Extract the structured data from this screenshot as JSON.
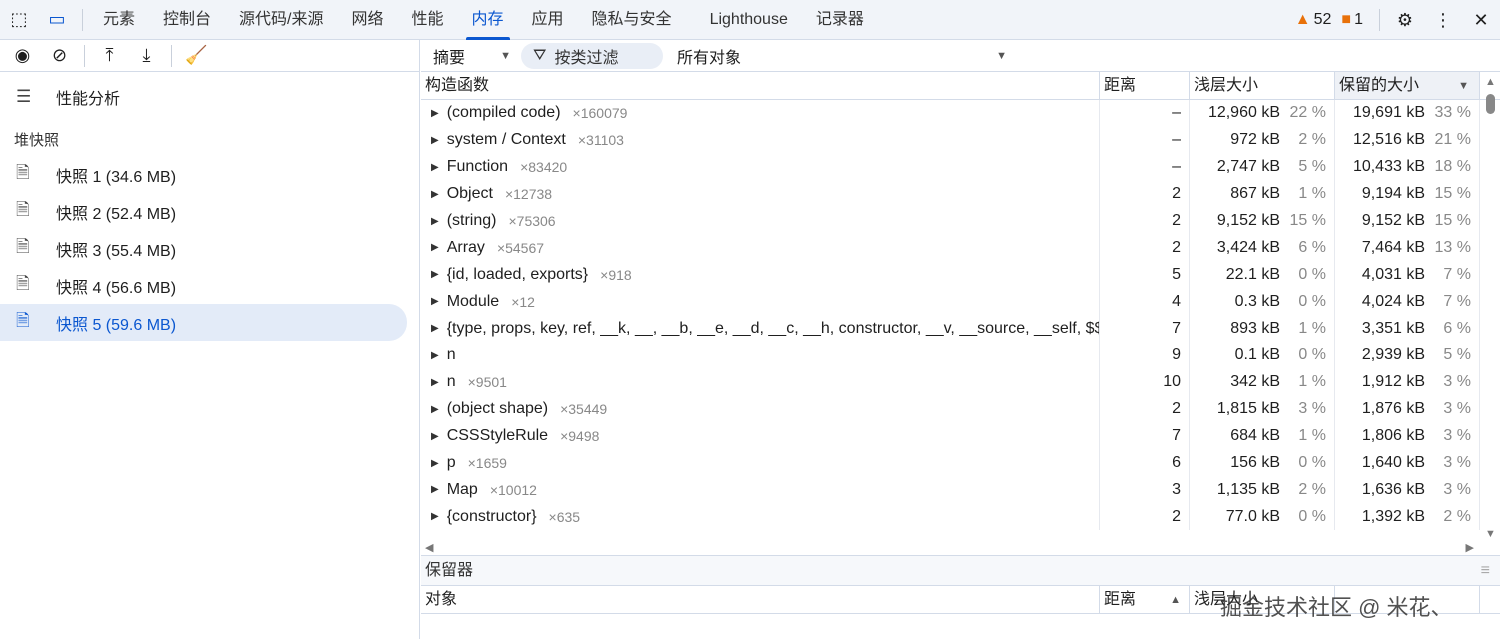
{
  "topbar": {
    "tabs": [
      "元素",
      "控制台",
      "源代码/来源",
      "网络",
      "性能",
      "内存",
      "应用",
      "隐私与安全",
      "Lighthouse",
      "记录器"
    ],
    "active_tab": "内存",
    "warnings": "52",
    "errors": "1"
  },
  "sidebar": {
    "profiling_label": "性能分析",
    "section": "堆快照",
    "snapshots": [
      "快照 1 (34.6 MB)",
      "快照 2 (52.4 MB)",
      "快照 3 (55.4 MB)",
      "快照 4 (56.6 MB)",
      "快照 5 (59.6 MB)"
    ],
    "selected": 4
  },
  "toolbar": {
    "view": "摘要",
    "filter_placeholder": "按类过滤",
    "objects": "所有对象"
  },
  "table": {
    "headers": {
      "constructor": "构造函数",
      "distance": "距离",
      "shallow": "浅层大小",
      "retained": "保留的大小"
    },
    "rows": [
      {
        "name": "(compiled code)",
        "count": "×160079",
        "distance": "–",
        "shallow": "12,960 kB",
        "shallow_pct": "22 %",
        "retained": "19,691 kB",
        "retained_pct": "33 %"
      },
      {
        "name": "system / Context",
        "count": "×31103",
        "distance": "–",
        "shallow": "972 kB",
        "shallow_pct": "2 %",
        "retained": "12,516 kB",
        "retained_pct": "21 %"
      },
      {
        "name": "Function",
        "count": "×83420",
        "distance": "–",
        "shallow": "2,747 kB",
        "shallow_pct": "5 %",
        "retained": "10,433 kB",
        "retained_pct": "18 %"
      },
      {
        "name": "Object",
        "count": "×12738",
        "distance": "2",
        "shallow": "867 kB",
        "shallow_pct": "1 %",
        "retained": "9,194 kB",
        "retained_pct": "15 %"
      },
      {
        "name": "(string)",
        "count": "×75306",
        "distance": "2",
        "shallow": "9,152 kB",
        "shallow_pct": "15 %",
        "retained": "9,152 kB",
        "retained_pct": "15 %"
      },
      {
        "name": "Array",
        "count": "×54567",
        "distance": "2",
        "shallow": "3,424 kB",
        "shallow_pct": "6 %",
        "retained": "7,464 kB",
        "retained_pct": "13 %"
      },
      {
        "name": "{id, loaded, exports}",
        "count": "×918",
        "distance": "5",
        "shallow": "22.1 kB",
        "shallow_pct": "0 %",
        "retained": "4,031 kB",
        "retained_pct": "7 %"
      },
      {
        "name": "Module",
        "count": "×12",
        "distance": "4",
        "shallow": "0.3 kB",
        "shallow_pct": "0 %",
        "retained": "4,024 kB",
        "retained_pct": "7 %"
      },
      {
        "name": "{type, props, key, ref, __k, __, __b, __e, __d, __c, __h, constructor, __v, __source, __self, $$...",
        "count": "",
        "distance": "7",
        "shallow": "893 kB",
        "shallow_pct": "1 %",
        "retained": "3,351 kB",
        "retained_pct": "6 %"
      },
      {
        "name": "n",
        "count": "",
        "distance": "9",
        "shallow": "0.1 kB",
        "shallow_pct": "0 %",
        "retained": "2,939 kB",
        "retained_pct": "5 %"
      },
      {
        "name": "n",
        "count": "×9501",
        "distance": "10",
        "shallow": "342 kB",
        "shallow_pct": "1 %",
        "retained": "1,912 kB",
        "retained_pct": "3 %"
      },
      {
        "name": "(object shape)",
        "count": "×35449",
        "distance": "2",
        "shallow": "1,815 kB",
        "shallow_pct": "3 %",
        "retained": "1,876 kB",
        "retained_pct": "3 %"
      },
      {
        "name": "CSSStyleRule",
        "count": "×9498",
        "distance": "7",
        "shallow": "684 kB",
        "shallow_pct": "1 %",
        "retained": "1,806 kB",
        "retained_pct": "3 %"
      },
      {
        "name": "p",
        "count": "×1659",
        "distance": "6",
        "shallow": "156 kB",
        "shallow_pct": "0 %",
        "retained": "1,640 kB",
        "retained_pct": "3 %"
      },
      {
        "name": "Map",
        "count": "×10012",
        "distance": "3",
        "shallow": "1,135 kB",
        "shallow_pct": "2 %",
        "retained": "1,636 kB",
        "retained_pct": "3 %"
      },
      {
        "name": "{constructor}",
        "count": "×635",
        "distance": "2",
        "shallow": "77.0 kB",
        "shallow_pct": "0 %",
        "retained": "1,392 kB",
        "retained_pct": "2 %"
      }
    ]
  },
  "retainers": {
    "title": "保留器",
    "headers": {
      "object": "对象",
      "distance": "距离",
      "shallow": "浅层大小"
    }
  },
  "watermark": "掘金技术社区 @ 米花、"
}
